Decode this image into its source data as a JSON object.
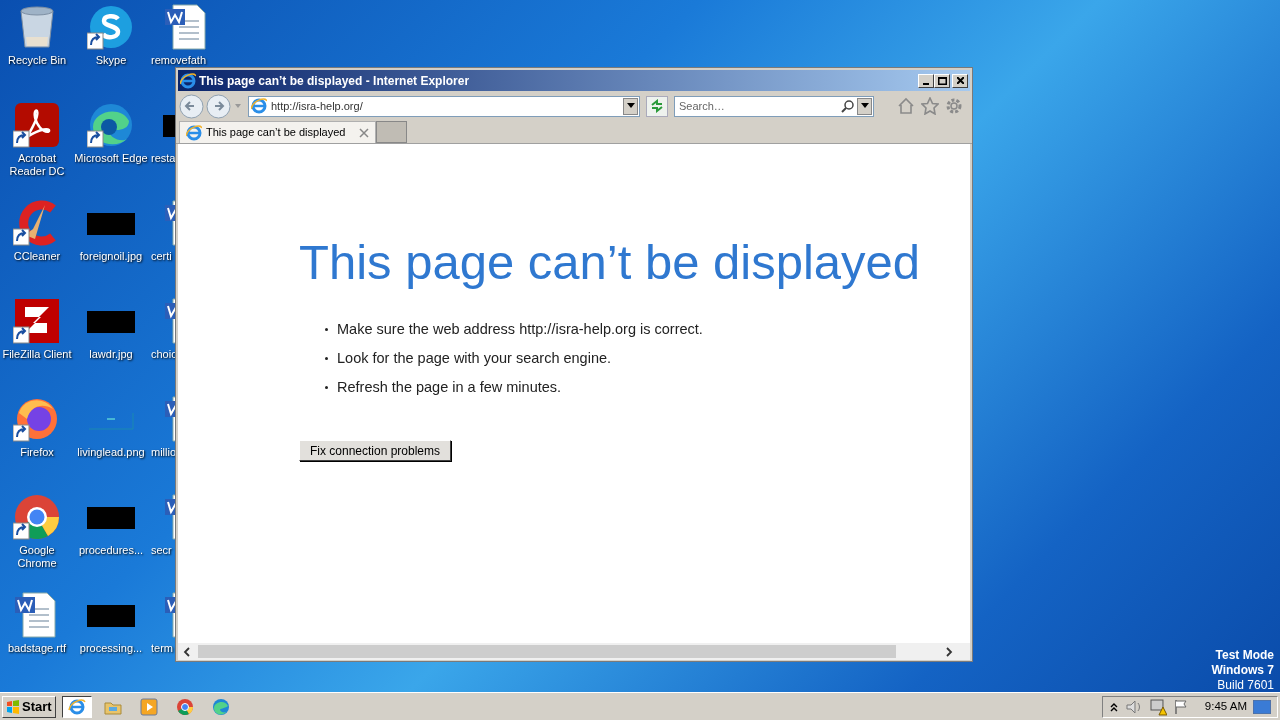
{
  "desktop_icons": [
    {
      "label": "Recycle Bin",
      "kind": "recycle",
      "shortcut": false
    },
    {
      "label": "Acrobat Reader DC",
      "kind": "acrobat",
      "shortcut": true
    },
    {
      "label": "CCleaner",
      "kind": "ccleaner",
      "shortcut": true
    },
    {
      "label": "FileZilla Client",
      "kind": "filezilla",
      "shortcut": true
    },
    {
      "label": "Firefox",
      "kind": "firefox",
      "shortcut": true
    },
    {
      "label": "Google Chrome",
      "kind": "chrome",
      "shortcut": true
    },
    {
      "label": "badstage.rtf",
      "kind": "word",
      "shortcut": false
    },
    {
      "label": "Skype",
      "kind": "skype",
      "shortcut": true
    },
    {
      "label": "Microsoft Edge",
      "kind": "edge",
      "shortcut": true
    },
    {
      "label": "foreignoil.jpg",
      "kind": "image",
      "shortcut": false
    },
    {
      "label": "lawdr.jpg",
      "kind": "image",
      "shortcut": false
    },
    {
      "label": "livinglead.png",
      "kind": "blank",
      "shortcut": false
    },
    {
      "label": "procedures...",
      "kind": "image",
      "shortcut": false
    },
    {
      "label": "processing...",
      "kind": "image",
      "shortcut": false
    },
    {
      "label": "removefath",
      "kind": "word",
      "shortcut": false
    },
    {
      "label": "resta",
      "kind": "image",
      "shortcut": false
    },
    {
      "label": "certi",
      "kind": "word",
      "shortcut": false
    },
    {
      "label": "choic",
      "kind": "word",
      "shortcut": false
    },
    {
      "label": "millio",
      "kind": "word",
      "shortcut": false
    },
    {
      "label": "secr",
      "kind": "word",
      "shortcut": false
    },
    {
      "label": "term",
      "kind": "word",
      "shortcut": false
    }
  ],
  "window": {
    "title": "This page can’t be displayed - Internet Explorer",
    "address": "http://isra-help.org/",
    "search": {
      "placeholder": "Search…"
    },
    "tabs": [
      {
        "label": "This page can’t be displayed",
        "selected": true
      }
    ],
    "heading": "This page can’t be displayed",
    "bullets": [
      "Make sure the web address http://isra-help.org is correct.",
      "Look for the page with your search engine.",
      "Refresh the page in a few minutes."
    ],
    "button": "Fix connection problems"
  },
  "taskbar": {
    "start": "Start",
    "apps": [
      {
        "kind": "ie",
        "selected": true
      },
      {
        "kind": "explorer",
        "selected": false
      },
      {
        "kind": "media",
        "selected": false
      },
      {
        "kind": "chrome",
        "selected": false
      },
      {
        "kind": "edge",
        "selected": false
      }
    ],
    "clock": "9:45 AM"
  },
  "test_mode": [
    {
      "text": "Test Mode",
      "bold": true
    },
    {
      "text": "Windows 7",
      "bold": true
    },
    {
      "text": "Build 7601",
      "bold": false
    }
  ]
}
